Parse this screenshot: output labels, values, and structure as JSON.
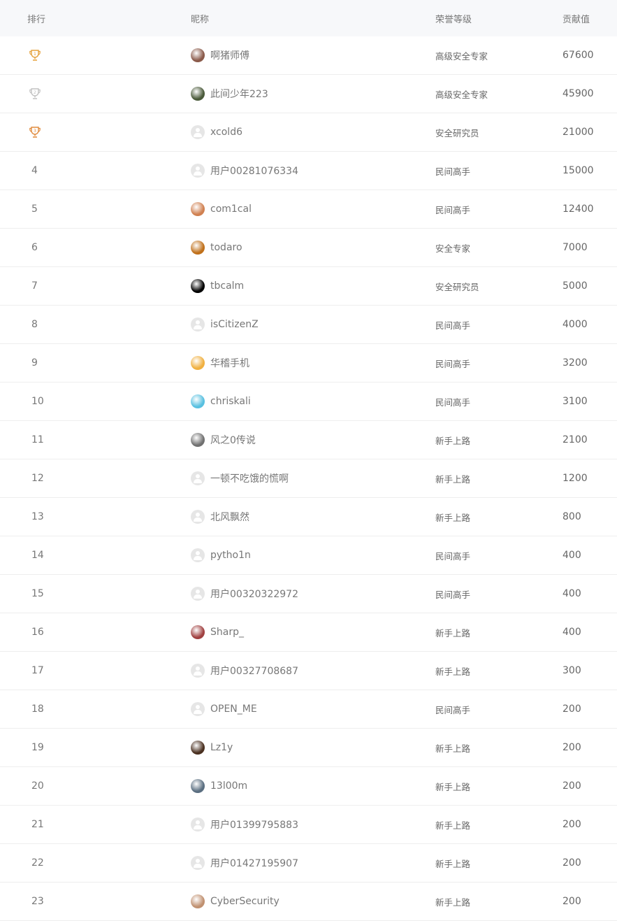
{
  "header": {
    "rank": "排行",
    "nickname": "昵称",
    "level": "荣誉等级",
    "score": "贡献值"
  },
  "colors": {
    "gold": "#e5a23c",
    "silver": "#c2c2c2",
    "bronze": "#e08a3c"
  },
  "rows": [
    {
      "rank": "1",
      "trophy": "gold",
      "avatar": "photo",
      "avatar_color": "#8a5a4a",
      "nickname": "啊猪师傅",
      "level": "高级安全专家",
      "score": "67600"
    },
    {
      "rank": "2",
      "trophy": "silver",
      "avatar": "photo",
      "avatar_color": "#4a5a3a",
      "nickname": "此间少年223",
      "level": "高级安全专家",
      "score": "45900"
    },
    {
      "rank": "3",
      "trophy": "bronze",
      "avatar": "default",
      "nickname": "xcold6",
      "level": "安全研究员",
      "score": "21000"
    },
    {
      "rank": "4",
      "avatar": "default",
      "nickname": "用户00281076334",
      "level": "民间高手",
      "score": "15000"
    },
    {
      "rank": "5",
      "avatar": "photo",
      "avatar_color": "#d08050",
      "nickname": "com1cal",
      "level": "民间高手",
      "score": "12400"
    },
    {
      "rank": "6",
      "avatar": "photo",
      "avatar_color": "#c0701a",
      "nickname": "todaro",
      "level": "安全专家",
      "score": "7000"
    },
    {
      "rank": "7",
      "avatar": "photo",
      "avatar_color": "#000000",
      "nickname": "tbcalm",
      "level": "安全研究员",
      "score": "5000"
    },
    {
      "rank": "8",
      "avatar": "default",
      "nickname": "isCitizenZ",
      "level": "民间高手",
      "score": "4000"
    },
    {
      "rank": "9",
      "avatar": "photo",
      "avatar_color": "#f0b040",
      "nickname": "华稽手机",
      "level": "民间高手",
      "score": "3200"
    },
    {
      "rank": "10",
      "avatar": "photo",
      "avatar_color": "#58c0e0",
      "nickname": "chriskali",
      "level": "民间高手",
      "score": "3100"
    },
    {
      "rank": "11",
      "avatar": "photo",
      "avatar_color": "#707070",
      "nickname": "风之0传说",
      "level": "新手上路",
      "score": "2100"
    },
    {
      "rank": "12",
      "avatar": "default",
      "nickname": "一顿不吃饿的慌啊",
      "level": "新手上路",
      "score": "1200"
    },
    {
      "rank": "13",
      "avatar": "default",
      "nickname": "北风飘然",
      "level": "新手上路",
      "score": "800"
    },
    {
      "rank": "14",
      "avatar": "default",
      "nickname": "pytho1n",
      "level": "民间高手",
      "score": "400"
    },
    {
      "rank": "15",
      "avatar": "default",
      "nickname": "用户00320322972",
      "level": "民间高手",
      "score": "400"
    },
    {
      "rank": "16",
      "avatar": "photo",
      "avatar_color": "#a04040",
      "nickname": "Sharp_",
      "level": "新手上路",
      "score": "400"
    },
    {
      "rank": "17",
      "avatar": "default",
      "nickname": "用户00327708687",
      "level": "新手上路",
      "score": "300"
    },
    {
      "rank": "18",
      "avatar": "default",
      "nickname": "OPEN_ME",
      "level": "民间高手",
      "score": "200"
    },
    {
      "rank": "19",
      "avatar": "photo",
      "avatar_color": "#4a3020",
      "nickname": "Lz1y",
      "level": "新手上路",
      "score": "200"
    },
    {
      "rank": "20",
      "avatar": "photo",
      "avatar_color": "#5a6e80",
      "nickname": "13l00m",
      "level": "新手上路",
      "score": "200"
    },
    {
      "rank": "21",
      "avatar": "default",
      "nickname": "用户01399795883",
      "level": "新手上路",
      "score": "200"
    },
    {
      "rank": "22",
      "avatar": "default",
      "nickname": "用户01427195907",
      "level": "新手上路",
      "score": "200"
    },
    {
      "rank": "23",
      "avatar": "photo",
      "avatar_color": "#c09070",
      "nickname": "CyberSecurity",
      "level": "新手上路",
      "score": "200"
    }
  ]
}
